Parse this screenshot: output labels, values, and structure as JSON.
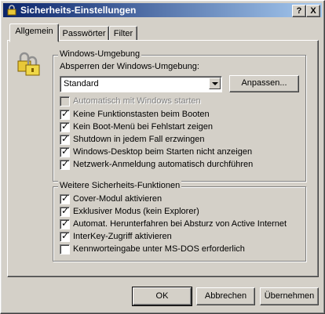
{
  "window": {
    "title": "Sicherheits-Einstellungen",
    "help_button": "?",
    "close_button": "X"
  },
  "tabs": [
    {
      "label": "Allgemein",
      "active": true
    },
    {
      "label": "Passwörter",
      "active": false
    },
    {
      "label": "Filter",
      "active": false
    }
  ],
  "windows_group": {
    "title": "Windows-Umgebung",
    "lock_label": "Absperren der Windows-Umgebung:",
    "select_value": "Standard",
    "customize_label": "Anpassen...",
    "options": [
      {
        "label": "Automatisch mit Windows starten",
        "checked": false,
        "disabled": true
      },
      {
        "label": "Keine Funktionstasten beim Booten",
        "checked": true,
        "disabled": false
      },
      {
        "label": "Kein Boot-Menü bei Fehlstart zeigen",
        "checked": true,
        "disabled": false
      },
      {
        "label": "Shutdown in jedem Fall erzwingen",
        "checked": true,
        "disabled": false
      },
      {
        "label": "Windows-Desktop beim Starten nicht anzeigen",
        "checked": true,
        "disabled": false
      },
      {
        "label": "Netzwerk-Anmeldung automatisch durchführen",
        "checked": true,
        "disabled": false
      }
    ]
  },
  "security_group": {
    "title": "Weitere Sicherheits-Funktionen",
    "options": [
      {
        "label": "Cover-Modul aktivieren",
        "checked": true
      },
      {
        "label": "Exklusiver Modus (kein Explorer)",
        "checked": true
      },
      {
        "label": "Automat. Herunterfahren bei Absturz von Active Internet",
        "checked": true
      },
      {
        "label": "InterKey-Zugriff aktivieren",
        "checked": true
      },
      {
        "label": "Kennworteingabe unter MS-DOS erforderlich",
        "checked": false
      }
    ]
  },
  "footer": {
    "ok_label": "OK",
    "cancel_label": "Abbrechen",
    "apply_label": "Übernehmen"
  },
  "colors": {
    "face": "#d4d0c8",
    "title_start": "#0a246a",
    "title_end": "#a6caf0",
    "lock_gold": "#e8c838"
  }
}
